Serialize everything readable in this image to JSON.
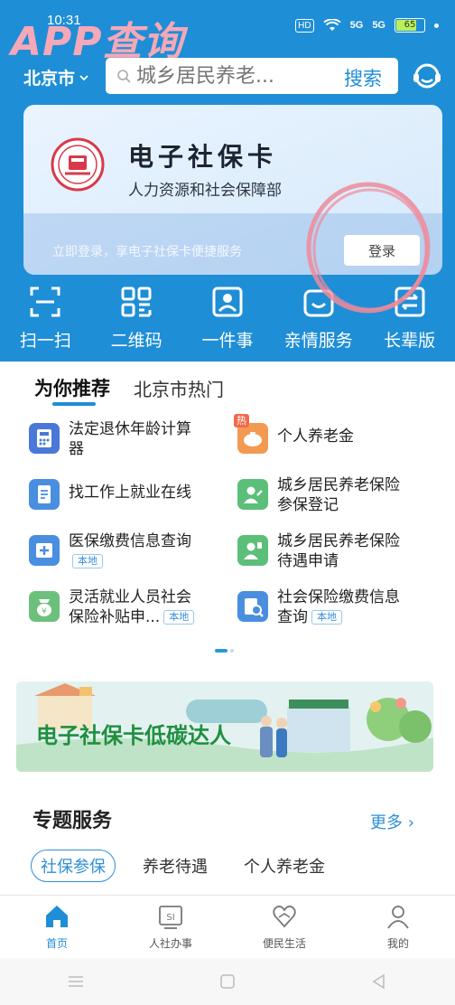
{
  "status": {
    "time": "10:31",
    "hd": "HD",
    "signal1": "5G",
    "signal2": "5G",
    "battery": "65"
  },
  "watermark": "APP查询",
  "header": {
    "city": "北京市",
    "search_placeholder": "城乡居民养老...",
    "search_button": "搜索"
  },
  "card": {
    "title": "电子社保卡",
    "subtitle": "人力资源和社会保障部",
    "tip": "立即登录，享电子社保卡便捷服务",
    "login_label": "登录"
  },
  "quick_actions": [
    {
      "label": "扫一扫",
      "icon": "scan-icon"
    },
    {
      "label": "二维码",
      "icon": "qrcode-icon"
    },
    {
      "label": "一件事",
      "icon": "one-thing-icon"
    },
    {
      "label": "亲情服务",
      "icon": "family-service-icon"
    },
    {
      "label": "长辈版",
      "icon": "elder-mode-icon"
    }
  ],
  "recommend": {
    "tabs": [
      "为你推荐",
      "北京市热门"
    ],
    "items": [
      {
        "line1": "法定退休年龄计算",
        "line2": "器",
        "tag": "",
        "icon": "calculator-icon",
        "color": "#4a78d8"
      },
      {
        "line1": "个人养老金",
        "line2": "",
        "tag": "",
        "hot": "热",
        "icon": "piggy-bank-icon",
        "color": "#f39a52"
      },
      {
        "line1": "找工作上就业在线",
        "line2": "",
        "tag": "",
        "icon": "document-icon",
        "color": "#4a8ee0"
      },
      {
        "line1": "城乡居民养老保险",
        "line2": "参保登记",
        "tag": "",
        "icon": "person-register-icon",
        "color": "#5bbf7a"
      },
      {
        "line1": "医保缴费信息查询",
        "line2": "",
        "tag": "本地",
        "icon": "medical-query-icon",
        "color": "#4a8ee0"
      },
      {
        "line1": "城乡居民养老保险",
        "line2": "待遇申请",
        "tag": "",
        "icon": "person-apply-icon",
        "color": "#5bbf7a"
      },
      {
        "line1": "灵活就业人员社会",
        "line2": "保险补贴申...",
        "tag": "本地",
        "icon": "subsidy-icon",
        "color": "#6cc07b"
      },
      {
        "line1": "社会保险缴费信息",
        "line2": "查询",
        "tag": "本地",
        "icon": "payment-query-icon",
        "color": "#4a8ee0"
      }
    ]
  },
  "banner": {
    "text": "电子社保卡低碳达人"
  },
  "topics": {
    "title": "专题服务",
    "more": "更多 ›",
    "tabs": [
      "社保参保",
      "养老待遇",
      "个人养老金"
    ]
  },
  "bottom_nav": [
    {
      "label": "首页",
      "icon": "home-icon",
      "active": true
    },
    {
      "label": "人社办事",
      "icon": "si-icon",
      "active": false
    },
    {
      "label": "便民生活",
      "icon": "heart-hands-icon",
      "active": false
    },
    {
      "label": "我的",
      "icon": "user-icon",
      "active": false
    }
  ],
  "colors": {
    "brand_blue": "#1e8ed6",
    "circle_mark": "#f08a9a"
  }
}
